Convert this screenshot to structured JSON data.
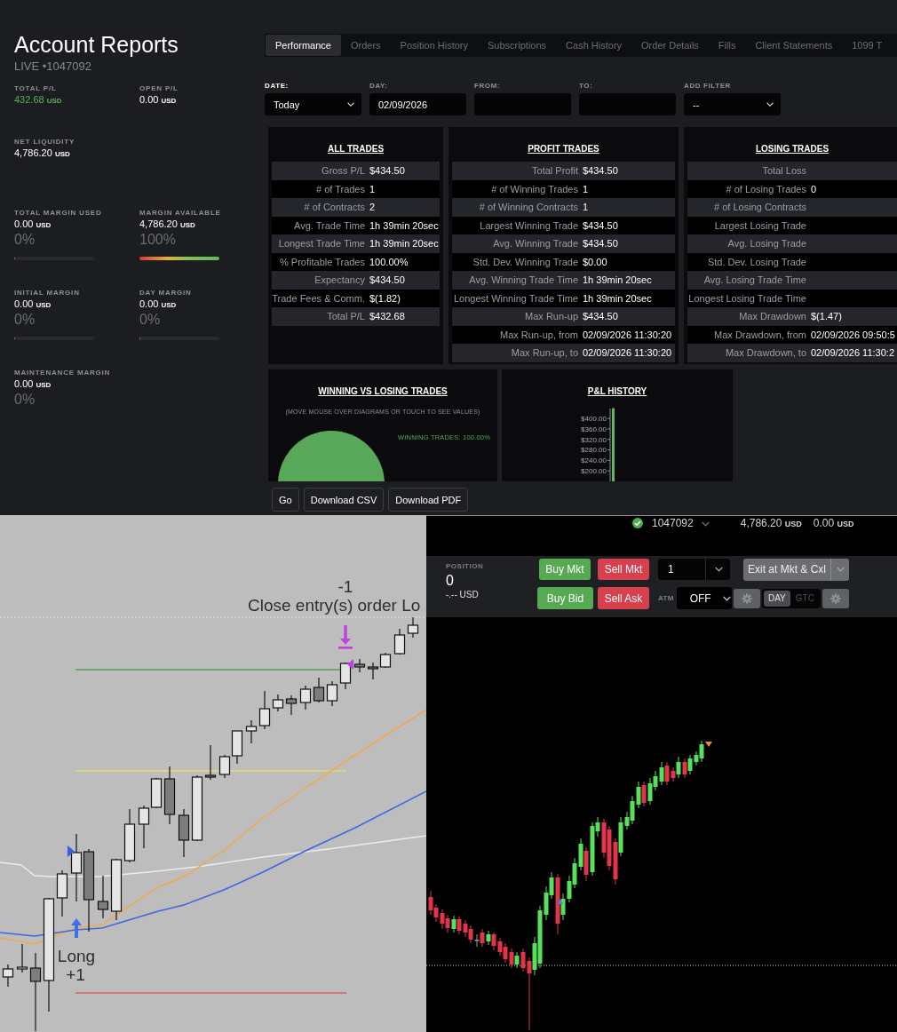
{
  "sidebar": {
    "title": "Account Reports",
    "account": "LIVE •1047092",
    "metric_rows": [
      [
        {
          "label": "TOTAL P/L",
          "value": "432.68",
          "unit": "USD",
          "color": "#5cae5c"
        },
        {
          "label": "OPEN P/L",
          "value": "0.00",
          "unit": "USD",
          "color": "#ffffff"
        }
      ],
      [
        {
          "label": "NET LIQUIDITY",
          "value": "4,786.20",
          "unit": "USD",
          "color": "#ffffff"
        }
      ],
      [
        {
          "label": "TOTAL MARGIN USED",
          "value": "0.00",
          "unit": "USD",
          "color": "#ffffff",
          "percent": "0%",
          "level": 0
        },
        {
          "label": "MARGIN AVAILABLE",
          "value": "4,786.20",
          "unit": "USD",
          "color": "#ffffff",
          "percent": "100%",
          "level": 1
        }
      ],
      [
        {
          "label": "INITIAL MARGIN",
          "value": "0.00",
          "unit": "USD",
          "color": "#ffffff",
          "percent": "0%",
          "level": 0
        },
        {
          "label": "DAY MARGIN",
          "value": "0.00",
          "unit": "USD",
          "color": "#ffffff",
          "percent": "0%",
          "level": 0
        }
      ],
      [
        {
          "label": "MAINTENANCE MARGIN",
          "value": "0.00",
          "unit": "USD",
          "color": "#ffffff",
          "percent": "0%"
        }
      ]
    ]
  },
  "tabs": [
    {
      "label": "Performance",
      "selected": true
    },
    {
      "label": "Orders",
      "selected": false
    },
    {
      "label": "Position History",
      "selected": false
    },
    {
      "label": "Subscriptions",
      "selected": false
    },
    {
      "label": "Cash History",
      "selected": false
    },
    {
      "label": "Order Details",
      "selected": false
    },
    {
      "label": "Fills",
      "selected": false
    },
    {
      "label": "Client Statements",
      "selected": false
    },
    {
      "label": "1099 T",
      "selected": false
    }
  ],
  "filters": [
    {
      "label": "DATE:",
      "kind": "select",
      "value": "Today",
      "active": true
    },
    {
      "label": "DAY:",
      "kind": "input",
      "value": "02/09/2026",
      "active": false
    },
    {
      "label": "FROM:",
      "kind": "input",
      "active": false
    },
    {
      "label": "TO:",
      "kind": "input",
      "active": false
    },
    {
      "label": "ADD FILTER",
      "kind": "select",
      "value": "--",
      "active": false
    }
  ],
  "stats_panels": [
    {
      "title": "ALL TRADES",
      "rows": [
        {
          "label": "Gross P/L",
          "value": "$434.50"
        },
        {
          "label": "# of Trades",
          "value": "1"
        },
        {
          "label": "# of Contracts",
          "value": "2"
        },
        {
          "label": "Avg. Trade Time",
          "value": "1h 39min 20sec"
        },
        {
          "label": "Longest Trade Time",
          "value": "1h 39min 20sec"
        },
        {
          "label": "% Profitable Trades",
          "value": "100.00%"
        },
        {
          "label": "Expectancy",
          "value": "$434.50"
        },
        {
          "label": "Trade Fees & Comm.",
          "value": "$(1.82)"
        },
        {
          "label": "Total P/L",
          "value": "$432.68"
        }
      ]
    },
    {
      "title": "PROFIT TRADES",
      "rows": [
        {
          "label": "Total Profit",
          "value": "$434.50"
        },
        {
          "label": "# of Winning Trades",
          "value": "1"
        },
        {
          "label": "# of Winning Contracts",
          "value": "1"
        },
        {
          "label": "Largest Winning Trade",
          "value": "$434.50"
        },
        {
          "label": "Avg. Winning Trade",
          "value": "$434.50"
        },
        {
          "label": "Std. Dev. Winning Trade",
          "value": "$0.00"
        },
        {
          "label": "Avg. Winning Trade Time",
          "value": "1h 39min 20sec"
        },
        {
          "label": "Longest Winning Trade Time",
          "value": "1h 39min 20sec"
        },
        {
          "label": "Max Run-up",
          "value": "$434.50"
        },
        {
          "label": "Max Run-up, from",
          "value": "02/09/2026 11:30:20"
        },
        {
          "label": "Max Run-up, to",
          "value": "02/09/2026 11:30:20"
        }
      ]
    },
    {
      "title": "LOSING TRADES",
      "rows": [
        {
          "label": "Total Loss"
        },
        {
          "label": "# of Losing Trades",
          "value": "0"
        },
        {
          "label": "# of Losing Contracts"
        },
        {
          "label": "Largest Losing Trade"
        },
        {
          "label": "Avg. Losing Trade"
        },
        {
          "label": "Std. Dev. Losing Trade"
        },
        {
          "label": "Avg. Losing Trade Time"
        },
        {
          "label": "Longest Losing Trade Time"
        },
        {
          "label": "Max Drawdown",
          "value": "$(1.47)"
        },
        {
          "label": "Max Drawdown, from",
          "value": "02/09/2026 09:50:5"
        },
        {
          "label": "Max Drawdown, to",
          "value": "02/09/2026 11:30:2"
        }
      ]
    }
  ],
  "charts": [
    {
      "title": "WINNING VS LOSING TRADES",
      "hint": "(MOVE MOUSE OVER DIAGRAMS OR TOUCH TO SEE VALUES)",
      "legend": "WINNING TRADES: 100.00%"
    },
    {
      "title": "P&L HISTORY",
      "axis_labels": [
        "$400.00",
        "$360.00",
        "$320.00",
        "$280.00",
        "$240.00",
        "$200.00"
      ]
    }
  ],
  "actions": [
    "Go",
    "Download CSV",
    "Download PDF"
  ],
  "price_chart": {
    "exit_marker": {
      "quantity": "-1",
      "label": "Close entry(s) order Lo"
    },
    "entry_marker": {
      "label": "Long",
      "quantity": "+1"
    }
  },
  "trade_panel": {
    "account_bar": {
      "account": "1047092",
      "balance": "4,786.20",
      "balance_unit": "USD",
      "open_pl": "0.00",
      "open_pl_unit": "USD"
    },
    "position": {
      "label": "POSITION",
      "value": "0",
      "pl": "-.-- USD"
    },
    "order_buttons": [
      {
        "label": "Buy Mkt",
        "kind": "buy"
      },
      {
        "label": "Sell Mkt",
        "kind": "sell"
      },
      {
        "label": "Buy Bid",
        "kind": "buy"
      },
      {
        "label": "Sell Ask",
        "kind": "sell"
      }
    ],
    "quantity": "1",
    "exit_button": "Exit at Mkt & Cxl",
    "atm": {
      "label": "ATM",
      "value": "OFF"
    },
    "time_in_force": [
      {
        "label": "DAY",
        "selected": true
      },
      {
        "label": "GTC",
        "selected": false
      }
    ]
  }
}
